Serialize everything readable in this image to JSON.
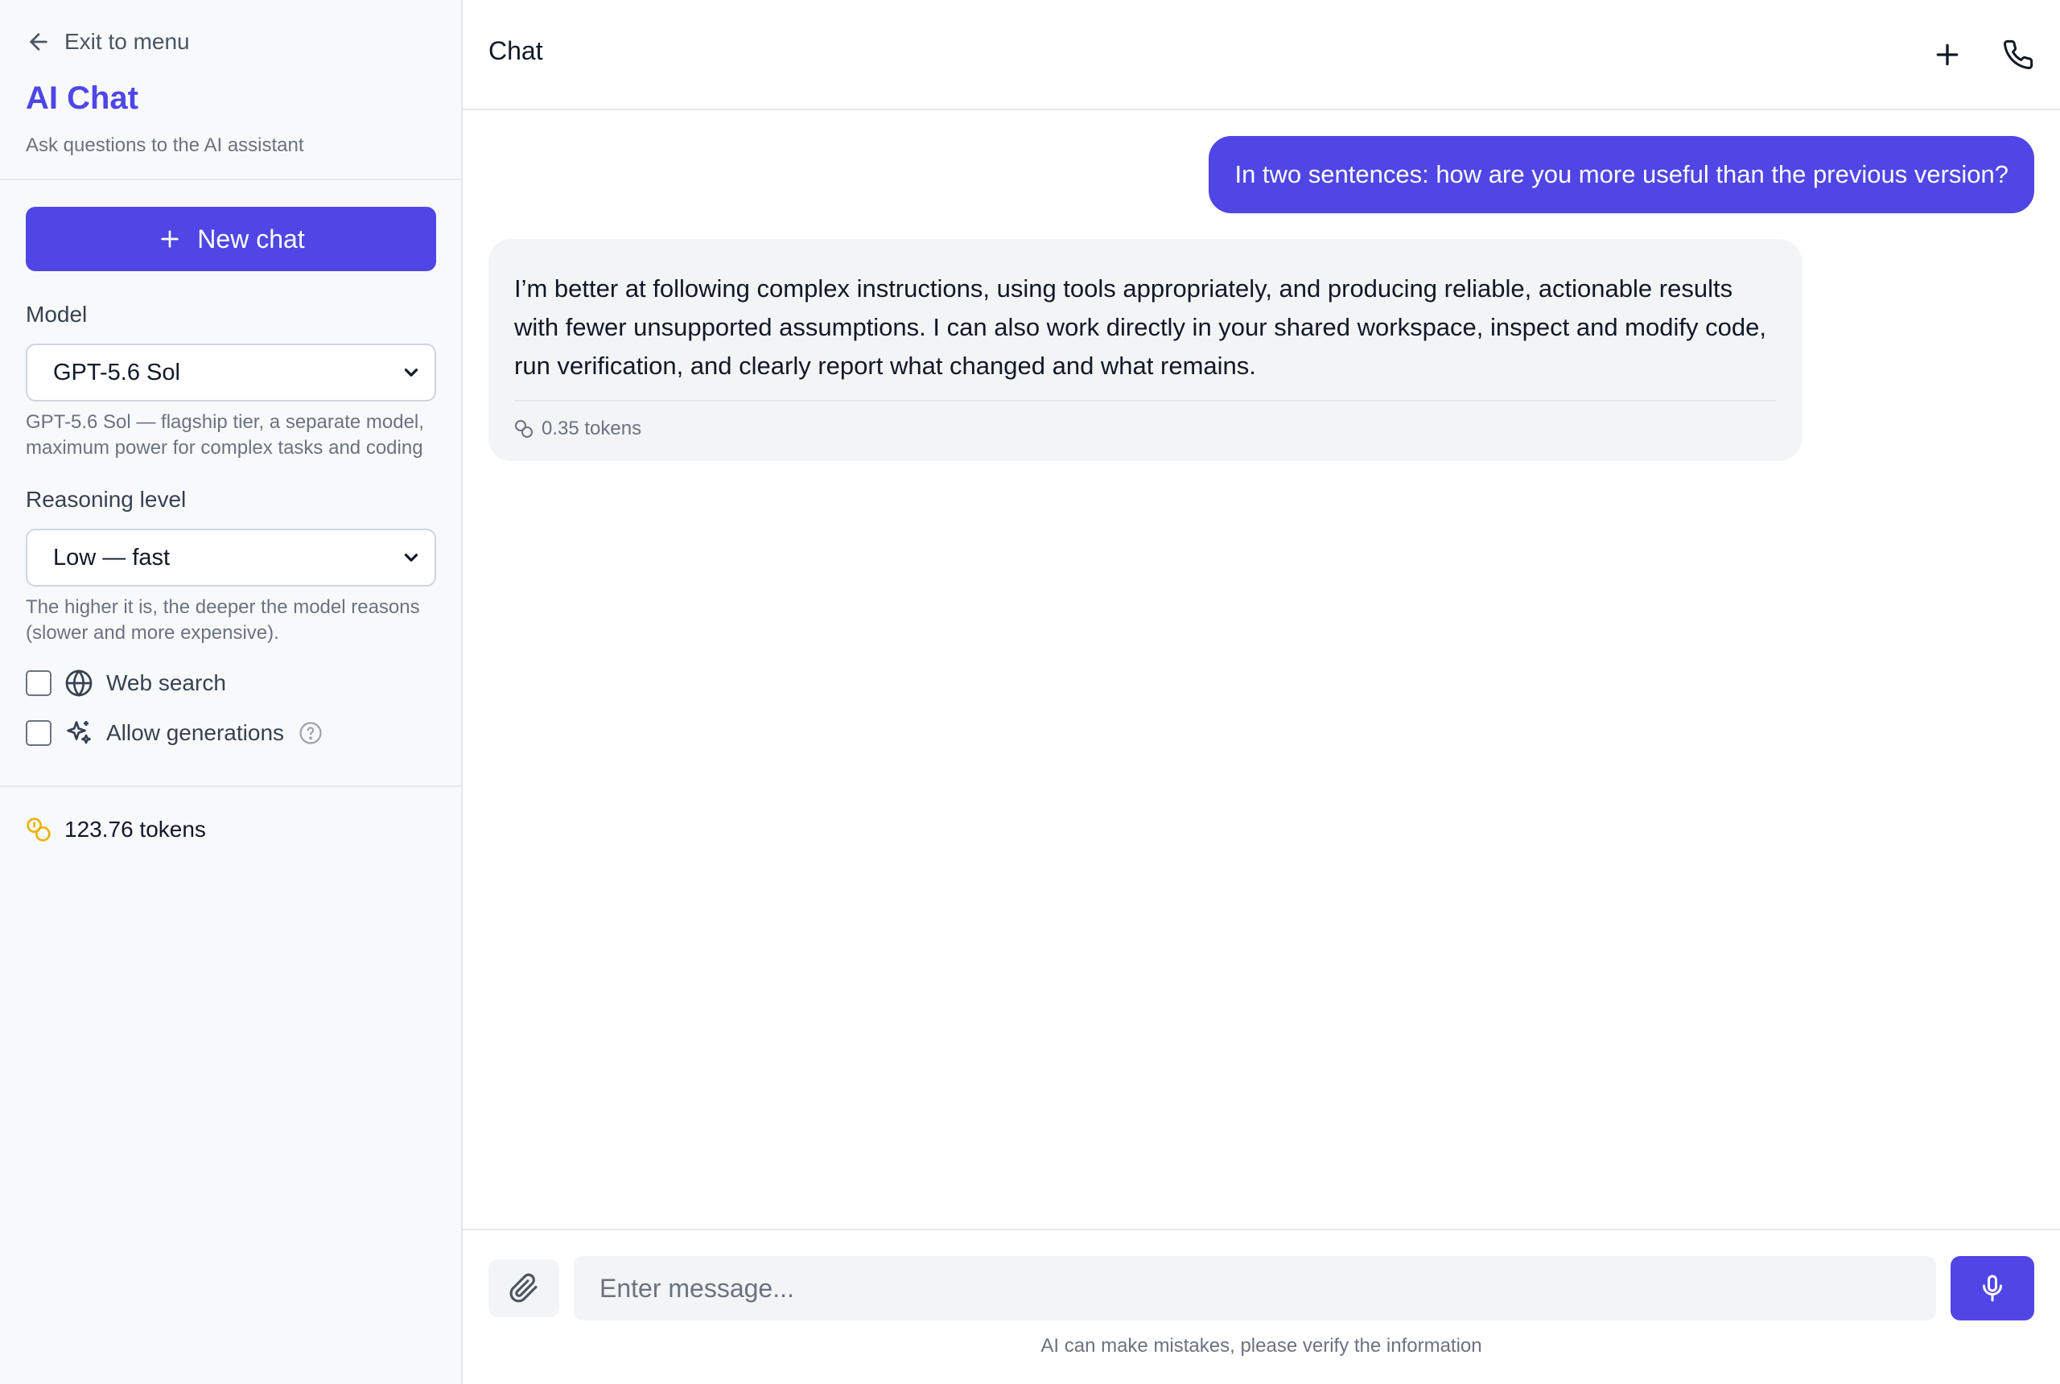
{
  "sidebar": {
    "exit_label": "Exit to menu",
    "app_title": "AI Chat",
    "app_subtitle": "Ask questions to the AI assistant",
    "new_chat_label": "New chat",
    "model_label": "Model",
    "model_selected": "GPT-5.6 Sol",
    "model_hint": "GPT-5.6 Sol — flagship tier, a separate model, maximum power for complex tasks and coding",
    "reasoning_label": "Reasoning level",
    "reasoning_selected": "Low — fast",
    "reasoning_hint": "The higher it is, the deeper the model reasons (slower and more expensive).",
    "web_search_label": "Web search",
    "web_search_checked": false,
    "allow_generations_label": "Allow generations",
    "allow_generations_checked": false,
    "token_balance": "123.76 tokens"
  },
  "header": {
    "title": "Chat"
  },
  "messages": [
    {
      "role": "user",
      "text": "In two sentences: how are you more useful than the previous version?"
    },
    {
      "role": "assistant",
      "text": "I’m better at following complex instructions, using tools appropriately, and producing reliable, actionable results with fewer unsupported assumptions. I can also work directly in your shared workspace, inspect and modify code, run verification, and clearly report what changed and what remains.",
      "tokens": "0.35 tokens"
    }
  ],
  "composer": {
    "placeholder": "Enter message...",
    "disclaimer": "AI can make mistakes, please verify the information"
  },
  "colors": {
    "accent": "#4f46e5",
    "coin": "#eab308"
  }
}
